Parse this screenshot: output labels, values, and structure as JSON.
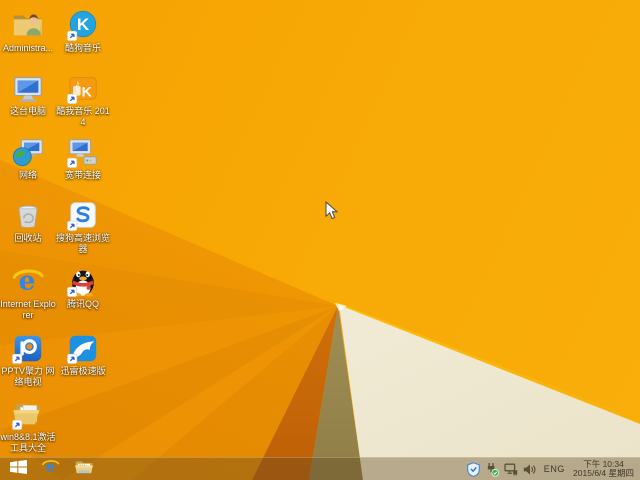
{
  "wallpaper": {
    "name": "windows-8.1-default-orange",
    "colors": {
      "orange_main": "#f8a905",
      "orange_deep": "#ea8f03",
      "cream_fold": "#f1ecd7",
      "olive_fold": "#a3925a",
      "edge_highlight": "#fec112"
    }
  },
  "desktop": {
    "icons": [
      {
        "id": "administrator-folder",
        "label": "Administra...",
        "icon": "user-folder",
        "shortcut": false,
        "col": 1,
        "row": 1
      },
      {
        "id": "kugou-music",
        "label": "酷狗音乐",
        "icon": "kugou",
        "shortcut": true,
        "col": 2,
        "row": 1
      },
      {
        "id": "this-pc",
        "label": "这台电脑",
        "icon": "computer",
        "shortcut": false,
        "col": 1,
        "row": 2
      },
      {
        "id": "kuwo-music-2014",
        "label": "酷我音乐 2014",
        "icon": "kuwo",
        "shortcut": true,
        "col": 2,
        "row": 2
      },
      {
        "id": "network",
        "label": "网络",
        "icon": "network",
        "shortcut": false,
        "col": 1,
        "row": 3
      },
      {
        "id": "broadband-connection",
        "label": "宽带连接",
        "icon": "broadband",
        "shortcut": true,
        "col": 2,
        "row": 3
      },
      {
        "id": "recycle-bin",
        "label": "回收站",
        "icon": "recycle",
        "shortcut": false,
        "col": 1,
        "row": 4
      },
      {
        "id": "sogou-browser",
        "label": "搜狗高速浏览器",
        "icon": "sogou",
        "shortcut": true,
        "col": 2,
        "row": 4
      },
      {
        "id": "internet-explorer",
        "label": "Internet Explorer",
        "icon": "ie",
        "shortcut": false,
        "col": 1,
        "row": 5
      },
      {
        "id": "tencent-qq",
        "label": "腾讯QQ",
        "icon": "qq",
        "shortcut": true,
        "col": 2,
        "row": 5
      },
      {
        "id": "pptv",
        "label": "PPTV聚力 网络电视",
        "icon": "pptv",
        "shortcut": true,
        "col": 1,
        "row": 6
      },
      {
        "id": "xunlei-speed",
        "label": "迅雷极速版",
        "icon": "xunlei",
        "shortcut": true,
        "col": 2,
        "row": 6
      },
      {
        "id": "win8-activation-tools",
        "label": "win8&8.1激活工具大全",
        "icon": "open-folder",
        "shortcut": true,
        "col": 1,
        "row": 7
      }
    ]
  },
  "taskbar": {
    "buttons": [
      {
        "id": "start",
        "icon": "windows-logo"
      },
      {
        "id": "internet-explorer",
        "icon": "ie"
      },
      {
        "id": "file-explorer",
        "icon": "explorer-folder"
      }
    ],
    "tray": {
      "icons": [
        "security-shield",
        "power-plug-ok",
        "network-wired",
        "volume"
      ],
      "language": "ENG",
      "time": "下午 10:34",
      "date": "2015/6/4 星期四"
    }
  }
}
